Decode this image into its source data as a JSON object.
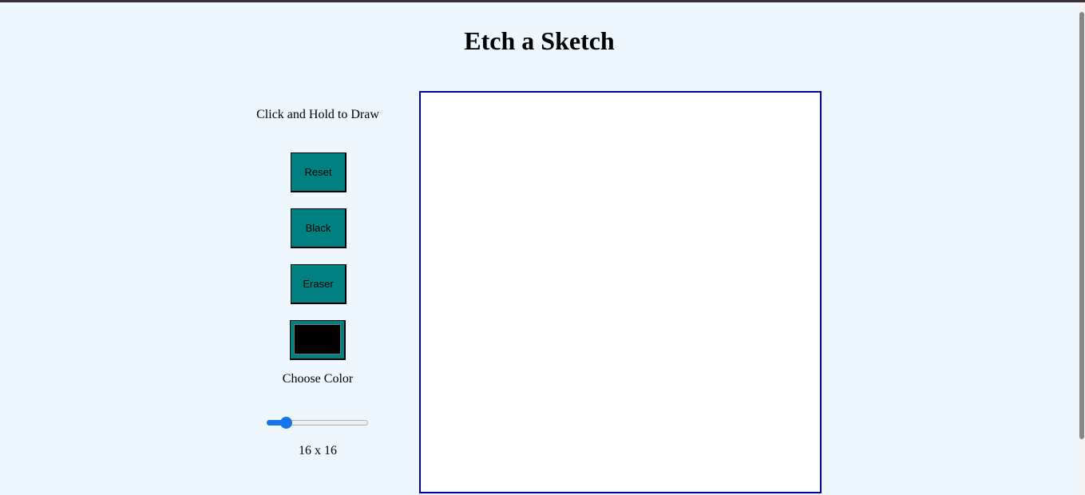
{
  "page": {
    "title": "Etch a Sketch"
  },
  "controls": {
    "instructions": "Click and Hold to Draw",
    "reset_label": "Reset",
    "black_label": "Black",
    "eraser_label": "Eraser",
    "choose_color_label": "Choose Color",
    "selected_color": "#000000",
    "grid_size_label": "16 x 16",
    "grid_slider": {
      "min": 1,
      "max": 100,
      "value": 16
    }
  },
  "colors": {
    "button_background": "#008080",
    "page_background": "#eef7fd",
    "board_border": "#0000b3",
    "slider_accent": "#1a73e8"
  }
}
